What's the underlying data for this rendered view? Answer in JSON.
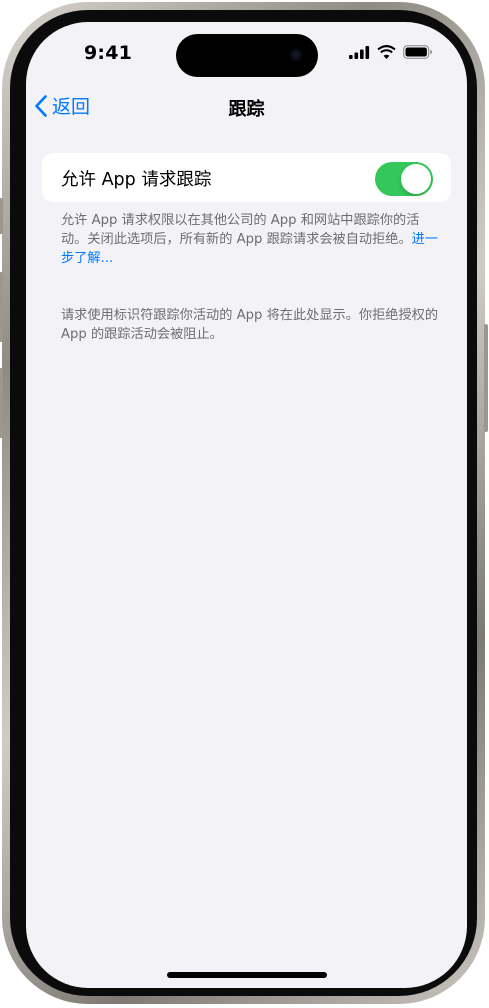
{
  "status_bar": {
    "time": "9:41",
    "icons": [
      "cellular-signal-icon",
      "wifi-icon",
      "battery-icon"
    ]
  },
  "nav": {
    "back_label": "返回",
    "back_icon": "chevron-left-icon",
    "title": "跟踪"
  },
  "setting": {
    "label": "允许 App 请求跟踪",
    "toggle_on": true
  },
  "description": {
    "text": "允许 App 请求权限以在其他公司的 App 和网站中跟踪你的活动。关闭此选项后，所有新的 App 跟踪请求会被自动拒绝。",
    "link": "进一步了解..."
  },
  "apps_note": "请求使用标识符跟踪你活动的 App 将在此处显示。你拒绝授权的 App 的跟踪活动会被阻止。",
  "colors": {
    "accent": "#007aff",
    "toggle_on": "#34c759",
    "background": "#f2f2f7",
    "secondary_text": "#6d6d72"
  }
}
